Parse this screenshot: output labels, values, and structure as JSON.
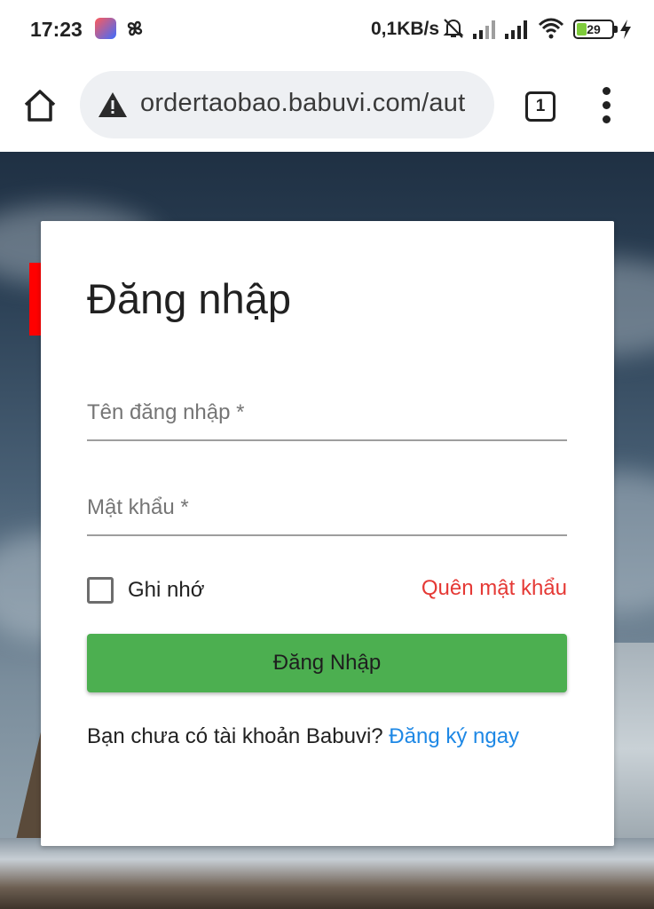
{
  "status_bar": {
    "time": "17:23",
    "network_speed": "0,1KB/s",
    "battery_level": "29",
    "battery_fraction": 0.29,
    "icons": [
      "app-icon",
      "pinwheel-icon",
      "bell-off-icon",
      "signal-icon",
      "signal-icon",
      "wifi-icon",
      "battery-icon",
      "charging-bolt-icon"
    ]
  },
  "browser": {
    "url": "ordertaobao.babuvi.com/aut",
    "tab_count": "1",
    "icons": [
      "home-icon",
      "warning-icon",
      "tabs-icon",
      "more-menu-icon"
    ]
  },
  "login_card": {
    "title": "Đăng nhập",
    "username_label": "Tên đăng nhập *",
    "password_label": "Mật khẩu *",
    "remember_label": "Ghi nhớ",
    "remember_checked": false,
    "forgot_password": "Quên mật khẩu",
    "submit_label": "Đăng Nhập",
    "no_account_text": "Bạn chưa có tài khoản Babuvi? ",
    "register_link": "Đăng ký ngay"
  },
  "colors": {
    "accent_red": "#ff0000",
    "button_green": "#4caf50",
    "link_blue": "#1e88e5",
    "forgot_red": "#e53935"
  }
}
